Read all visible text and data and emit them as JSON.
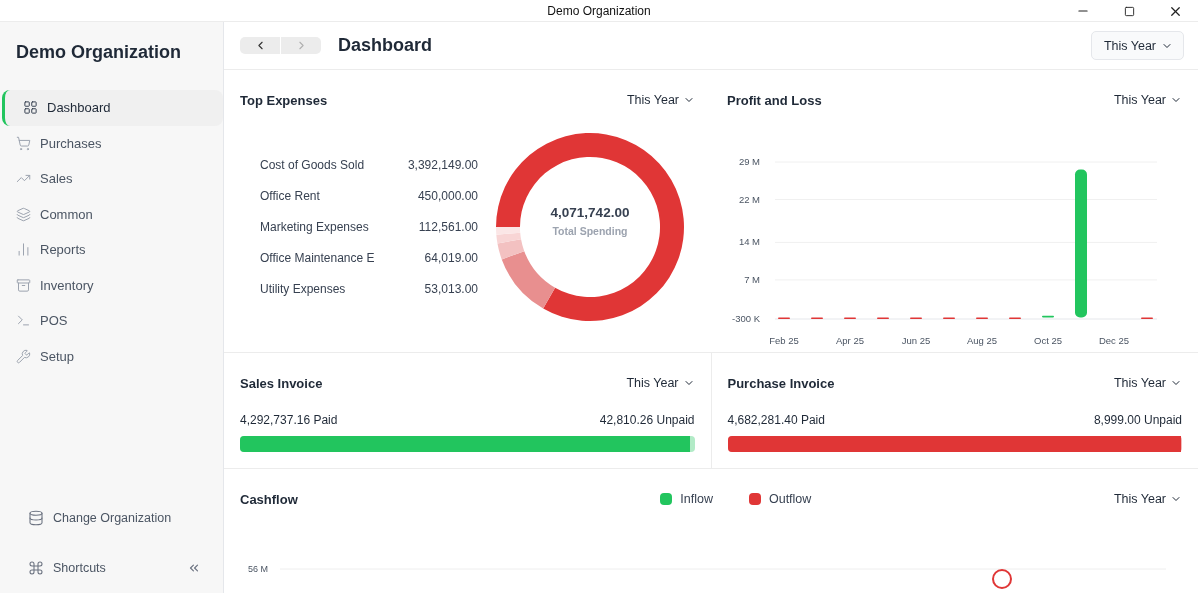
{
  "window": {
    "title": "Demo Organization"
  },
  "sidebar": {
    "title": "Demo Organization",
    "items": [
      {
        "label": "Dashboard",
        "selected": true
      },
      {
        "label": "Purchases",
        "selected": false
      },
      {
        "label": "Sales",
        "selected": false
      },
      {
        "label": "Common",
        "selected": false
      },
      {
        "label": "Reports",
        "selected": false
      },
      {
        "label": "Inventory",
        "selected": false
      },
      {
        "label": "POS",
        "selected": false
      },
      {
        "label": "Setup",
        "selected": false
      }
    ],
    "footer": [
      {
        "label": "Change Organization"
      },
      {
        "label": "Shortcuts"
      }
    ]
  },
  "header": {
    "title": "Dashboard",
    "back_disabled": false,
    "forward_disabled": true,
    "period": "This Year"
  },
  "top_expenses": {
    "title": "Top Expenses",
    "period": "This Year",
    "rows": [
      {
        "name": "Cost of Goods Sold",
        "amount": "3,392,149.00"
      },
      {
        "name": "Office Rent",
        "amount": "450,000.00"
      },
      {
        "name": "Marketing Expenses",
        "amount": "112,561.00"
      },
      {
        "name": "Office Maintenance E",
        "amount": "64,019.00"
      },
      {
        "name": "Utility Expenses",
        "amount": "53,013.00"
      }
    ],
    "total": "4,071,742.00",
    "total_label": "Total Spending",
    "chart_data": {
      "type": "donut",
      "values": [
        83.3,
        11.1,
        2.8,
        1.5,
        1.3
      ]
    }
  },
  "profit_and_loss": {
    "title": "Profit and Loss",
    "period": "This Year",
    "chart_data": {
      "type": "bar",
      "ylim": [
        -0.3,
        29
      ],
      "grid": true,
      "yticks": [
        {
          "value": 29,
          "label": "29 M"
        },
        {
          "value": 22,
          "label": "22 M"
        },
        {
          "value": 14,
          "label": "14 M"
        },
        {
          "value": 7,
          "label": "7 M"
        },
        {
          "value": -0.3,
          "label": "-300 K"
        }
      ],
      "categories": [
        "Feb 25",
        null,
        "Apr 25",
        null,
        "Jun 25",
        null,
        "Aug 25",
        null,
        "Oct 25",
        null,
        "Dec 25",
        null
      ],
      "series": [
        {
          "color": "#22c55e",
          "values": [
            null,
            null,
            null,
            null,
            null,
            null,
            null,
            null,
            0.3,
            27.6,
            null,
            null
          ]
        },
        {
          "color": "#e03636",
          "values": [
            -0.3,
            -0.3,
            -0.3,
            -0.3,
            -0.3,
            -0.3,
            -0.3,
            -0.3,
            null,
            null,
            null,
            -0.3
          ]
        }
      ]
    }
  },
  "sales_invoice": {
    "title": "Sales Invoice",
    "period": "This Year",
    "paid": "4,292,737.16 Paid",
    "unpaid": "42,810.26 Unpaid",
    "level": 0.99,
    "color": "#22c55e"
  },
  "purchase_invoice": {
    "title": "Purchase Invoice",
    "period": "This Year",
    "paid": "4,682,281.40 Paid",
    "unpaid": "8,999.00 Unpaid",
    "level": 0.998,
    "color": "#e03636"
  },
  "cashflow": {
    "title": "Cashflow",
    "period": "This Year",
    "legend": [
      {
        "label": "Inflow",
        "color": "#22c55e"
      },
      {
        "label": "Outflow",
        "color": "#e03636"
      }
    ],
    "axis_label": "56 M"
  }
}
